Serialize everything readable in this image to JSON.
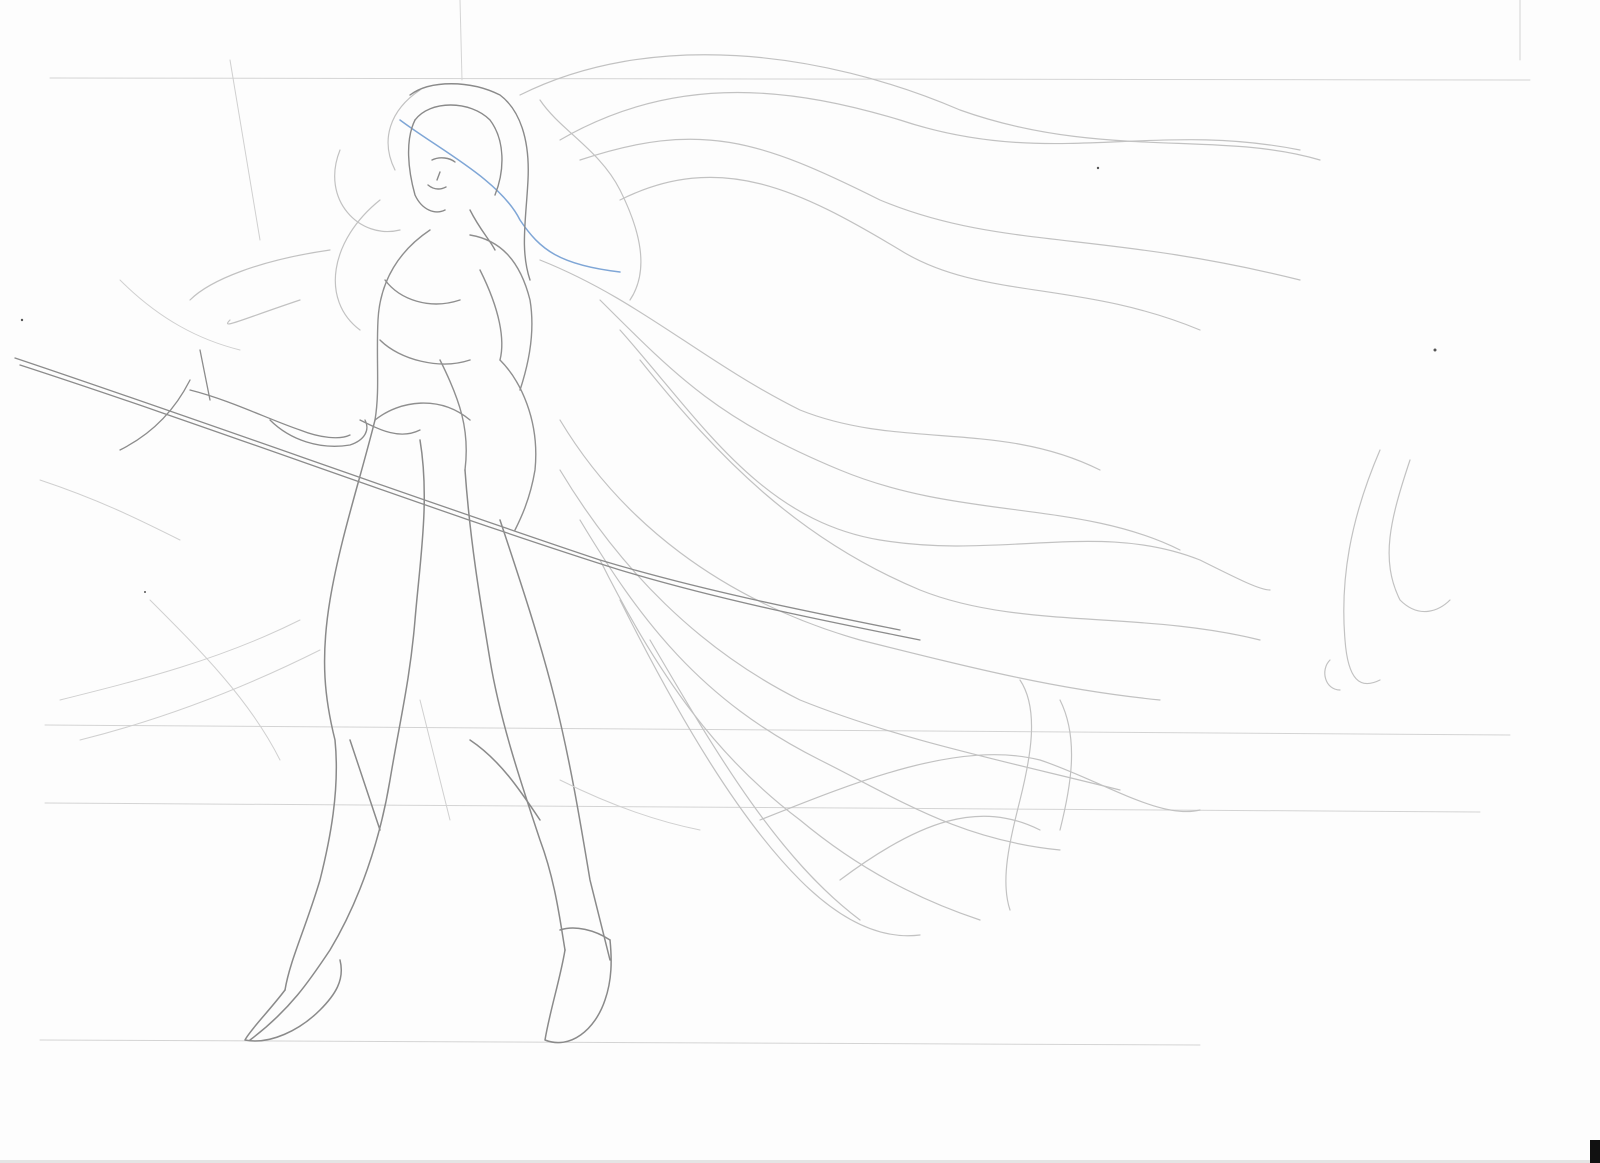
{
  "artwork": {
    "subject": "pencil-sketch-archer-woman",
    "medium": "graphite-and-blue-pencil",
    "colors": {
      "paper": "#fdfdfd",
      "graphite": "#8a8a8a",
      "graphite_light": "#c4c4c4",
      "blue_pencil": "#7fa6d6"
    }
  }
}
